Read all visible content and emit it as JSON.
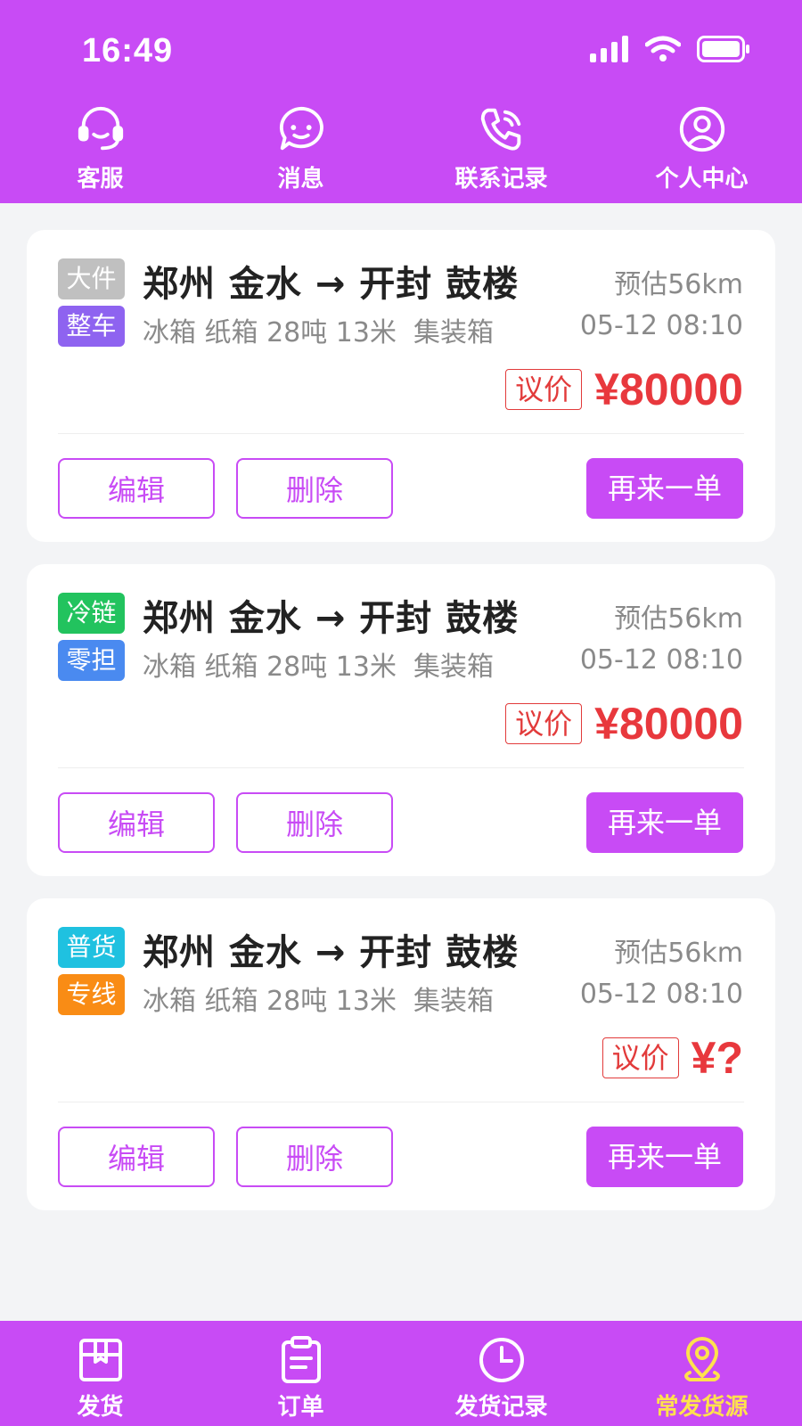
{
  "status_bar": {
    "time": "16:49"
  },
  "top_nav": [
    {
      "label": "客服",
      "icon": "headset-icon"
    },
    {
      "label": "消息",
      "icon": "chat-bubble-icon"
    },
    {
      "label": "联系记录",
      "icon": "phone-log-icon"
    },
    {
      "label": "个人中心",
      "icon": "user-icon"
    }
  ],
  "cards": [
    {
      "tag1": "大件",
      "tag1_color": "#c0c0c0",
      "tag2": "整车",
      "tag2_color": "#8e63f0",
      "route": "郑州 金水 → 开封 鼓楼",
      "distance": "预估56km",
      "cargo": "冰箱 纸箱 28吨 13米  集装箱",
      "datetime": "05-12 08:10",
      "negotiable": "议价",
      "price": "¥80000",
      "edit": "编辑",
      "delete": "删除",
      "reorder": "再来一单"
    },
    {
      "tag1": "冷链",
      "tag1_color": "#22c35e",
      "tag2": "零担",
      "tag2_color": "#4a8af0",
      "route": "郑州 金水 → 开封 鼓楼",
      "distance": "预估56km",
      "cargo": "冰箱 纸箱 28吨 13米  集装箱",
      "datetime": "05-12 08:10",
      "negotiable": "议价",
      "price": "¥80000",
      "edit": "编辑",
      "delete": "删除",
      "reorder": "再来一单"
    },
    {
      "tag1": "普货",
      "tag1_color": "#1fc1e0",
      "tag2": "专线",
      "tag2_color": "#f98c15",
      "route": "郑州 金水 → 开封 鼓楼",
      "distance": "预估56km",
      "cargo": "冰箱 纸箱 28吨 13米  集装箱",
      "datetime": "05-12 08:10",
      "negotiable": "议价",
      "price": "¥?",
      "edit": "编辑",
      "delete": "删除",
      "reorder": "再来一单"
    }
  ],
  "bottom_nav": [
    {
      "label": "发货",
      "icon": "box-icon",
      "active": false
    },
    {
      "label": "订单",
      "icon": "clipboard-icon",
      "active": false
    },
    {
      "label": "发货记录",
      "icon": "clock-icon",
      "active": false
    },
    {
      "label": "常发货源",
      "icon": "location-pin-icon",
      "active": true
    }
  ],
  "colors": {
    "brand": "#c84bf5",
    "price": "#e8383d",
    "active_tab": "#ffe14d"
  }
}
